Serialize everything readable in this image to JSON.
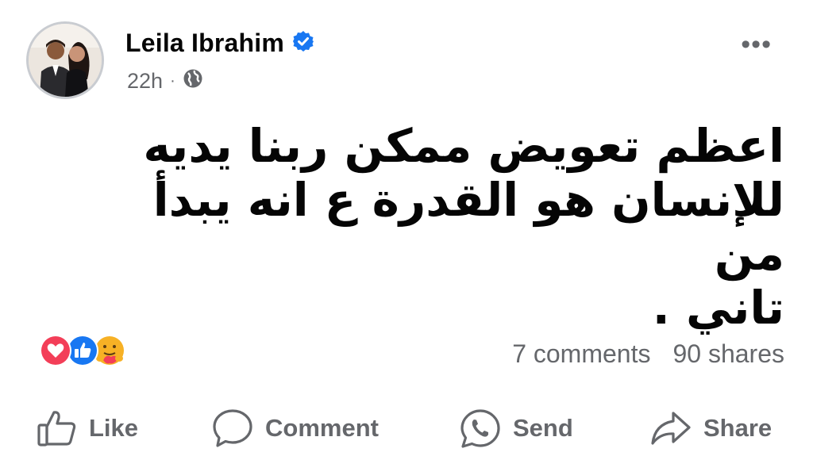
{
  "post": {
    "author": "Leila Ibrahim",
    "verified": true,
    "time": "22h",
    "separator": "·",
    "privacy_icon": "globe-icon",
    "more_label": "•••",
    "lines": [
      "اعظم تعويض ممكن ربنا يديه",
      "للإنسان هو القدرة ع انه يبدأ من",
      "تاني ."
    ],
    "reactions": [
      "love",
      "like",
      "care"
    ],
    "comments": "7 comments",
    "shares": "90 shares"
  },
  "actions": {
    "like": "Like",
    "comment": "Comment",
    "send": "Send",
    "share": "Share"
  },
  "colors": {
    "verified": "#1877f2",
    "like": "#1877f2",
    "love": "#f33e58",
    "care": "#f7b125",
    "secondary_text": "#65676b"
  }
}
